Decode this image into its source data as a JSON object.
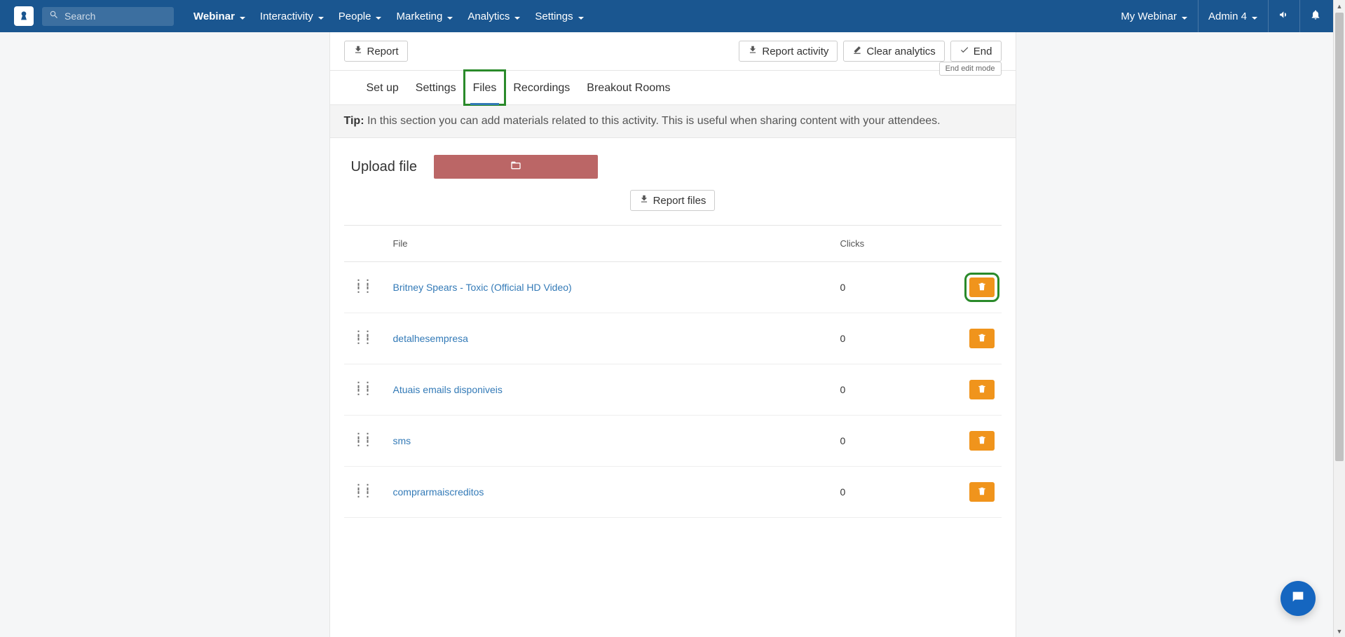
{
  "search": {
    "placeholder": "Search"
  },
  "nav": {
    "webinar": "Webinar",
    "interactivity": "Interactivity",
    "people": "People",
    "marketing": "Marketing",
    "analytics": "Analytics",
    "settings": "Settings"
  },
  "top_right": {
    "my_webinar": "My Webinar",
    "admin": "Admin 4"
  },
  "toolbar": {
    "report": "Report",
    "report_activity": "Report activity",
    "clear_analytics": "Clear analytics",
    "end": "End",
    "tooltip": "End edit mode"
  },
  "tabs": {
    "setup": "Set up",
    "settings": "Settings",
    "files": "Files",
    "recordings": "Recordings",
    "breakout": "Breakout Rooms"
  },
  "tip": {
    "label": "Tip:",
    "text": "In this section you can add materials related to this activity. This is useful when sharing content with your attendees."
  },
  "upload": {
    "label": "Upload file"
  },
  "report_files": "Report files",
  "table": {
    "headers": {
      "file": "File",
      "clicks": "Clicks"
    },
    "rows": [
      {
        "name": "Britney Spears - Toxic (Official HD Video)",
        "clicks": "0"
      },
      {
        "name": "detalhesempresa",
        "clicks": "0"
      },
      {
        "name": "Atuais emails disponiveis",
        "clicks": "0"
      },
      {
        "name": "sms",
        "clicks": "0"
      },
      {
        "name": "comprarmaiscreditos",
        "clicks": "0"
      }
    ]
  }
}
